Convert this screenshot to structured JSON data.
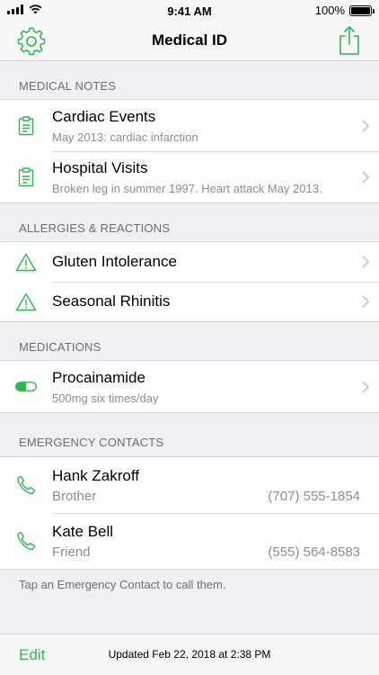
{
  "status_bar": {
    "time": "9:41 AM",
    "battery_text": "100%",
    "battery_level": 1.0
  },
  "nav": {
    "title": "Medical ID",
    "left_icon": "gear-icon",
    "right_icon": "share-icon"
  },
  "colors": {
    "accent": "#2db84d",
    "background": "#efeff4",
    "secondary_text": "#8e8e93"
  },
  "sections": {
    "notes": {
      "header": "MEDICAL NOTES",
      "items": [
        {
          "title": "Cardiac Events",
          "subtitle": "May 2013: cardiac infarction",
          "icon": "clipboard-icon"
        },
        {
          "title": "Hospital Visits",
          "subtitle": "Broken leg in summer 1997.  Heart attack May 2013.",
          "icon": "clipboard-icon"
        }
      ]
    },
    "allergies": {
      "header": "ALLERGIES & REACTIONS",
      "items": [
        {
          "title": "Gluten Intolerance",
          "icon": "warning-icon"
        },
        {
          "title": "Seasonal Rhinitis",
          "icon": "warning-icon"
        }
      ]
    },
    "medications": {
      "header": "MEDICATIONS",
      "items": [
        {
          "title": "Procainamide",
          "subtitle": "500mg six times/day",
          "icon": "pill-icon"
        }
      ]
    },
    "contacts": {
      "header": "EMERGENCY CONTACTS",
      "items": [
        {
          "name": "Hank Zakroff",
          "relation": "Brother",
          "phone": "(707) 555-1854",
          "icon": "phone-icon"
        },
        {
          "name": "Kate Bell",
          "relation": "Friend",
          "phone": "(555) 564-8583",
          "icon": "phone-icon"
        }
      ],
      "footer": "Tap an Emergency Contact to call them."
    }
  },
  "toolbar": {
    "edit_label": "Edit",
    "updated": "Updated Feb 22, 2018 at 2:38 PM"
  }
}
